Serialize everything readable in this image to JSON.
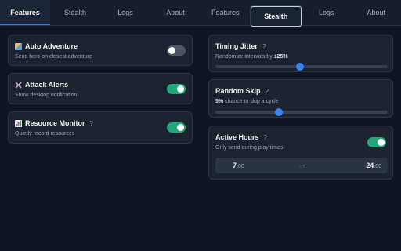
{
  "tabs": [
    "Features",
    "Stealth",
    "Logs",
    "About"
  ],
  "features_panel": {
    "active_tab": "Features",
    "cards": [
      {
        "title": "Auto Adventure",
        "desc": "Send hero on closest adventure",
        "enabled": false,
        "help": false,
        "icon": "map-icon"
      },
      {
        "title": "Attack Alerts",
        "desc": "Show desktop notification",
        "enabled": true,
        "help": false,
        "icon": "crossed-swords-icon"
      },
      {
        "title": "Resource Monitor",
        "desc": "Quietly record resources",
        "enabled": true,
        "help": true,
        "icon": "bar-chart-icon"
      }
    ]
  },
  "stealth_panel": {
    "active_tab": "Stealth",
    "timing_jitter": {
      "title": "Timing Jitter",
      "help": "?",
      "desc_prefix": "Randomize intervals by ",
      "value_label": "±25%",
      "slider_fraction": 0.49
    },
    "random_skip": {
      "title": "Random Skip",
      "help": "?",
      "value_label": "5%",
      "desc_suffix": " chance to skip a cycle",
      "slider_fraction": 0.37
    },
    "active_hours": {
      "title": "Active Hours",
      "help": "?",
      "desc": "Only send during play times",
      "enabled": true,
      "start_hour": "7",
      "end_hour": "24",
      "minutes": ":00",
      "arrow": "→"
    }
  },
  "colors": {
    "accent_blue": "#3b82f6",
    "toggle_on": "#22a876",
    "toggle_off": "#4b5567",
    "background": "#0f1522",
    "card": "#1b2230"
  }
}
